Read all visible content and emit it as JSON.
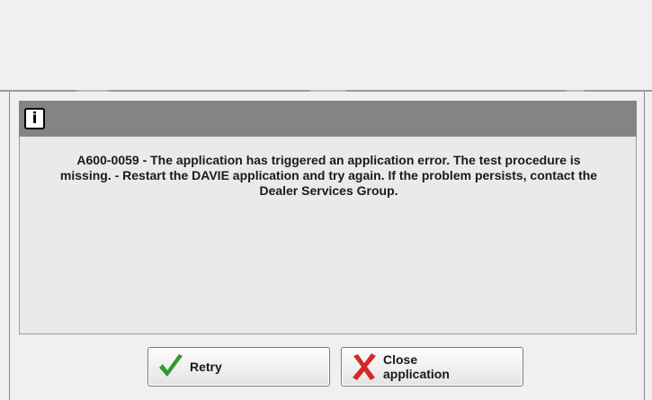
{
  "dialog": {
    "icon": "info-icon",
    "icon_glyph": "i",
    "message": "A600-0059 - The application has triggered an application error. The test procedure is missing. - Restart the DAVIE application and try again. If the problem persists, contact the Dealer Services Group."
  },
  "buttons": {
    "retry": {
      "label": "Retry",
      "icon": "checkmark-icon",
      "icon_color": "#2e9b2e"
    },
    "close": {
      "label": "Close application",
      "icon": "x-mark-icon",
      "icon_color": "#d42a2a"
    }
  },
  "colors": {
    "header": "#848484",
    "background": "#f0f0f0"
  }
}
